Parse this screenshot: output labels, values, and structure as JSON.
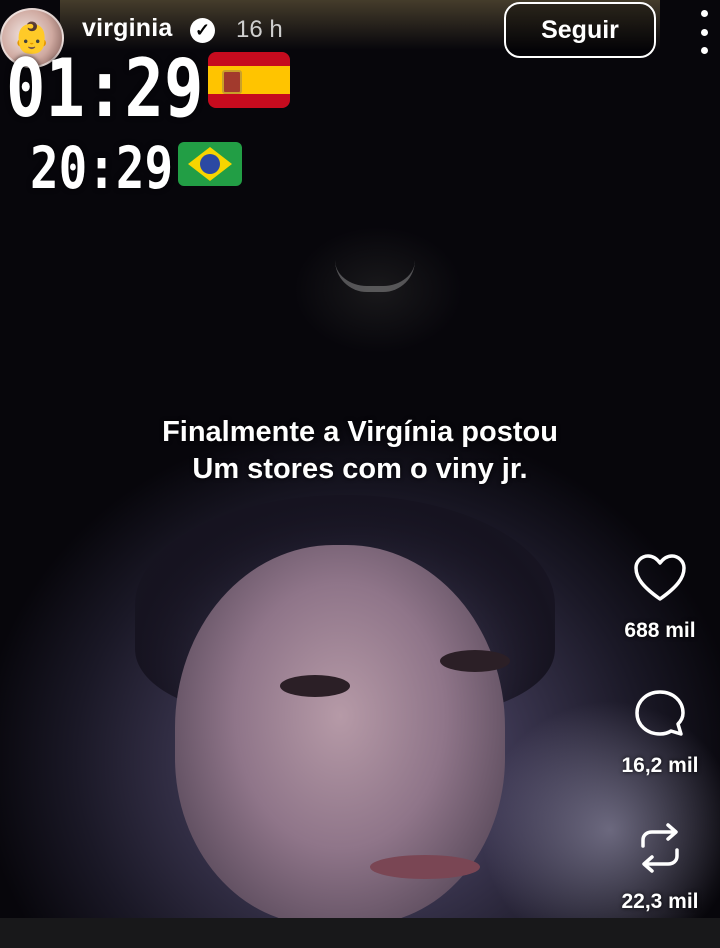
{
  "header": {
    "username": "virginia",
    "verified_icon": "verified-check-icon",
    "time_ago": "16 h",
    "follow_label": "Seguir",
    "more_icon": "more-vertical-icon"
  },
  "overlay": {
    "spain_time": "01:29",
    "brazil_time": "20:29",
    "spain_flag": "spain-flag-icon",
    "brazil_flag": "brazil-flag-icon",
    "caption_line1": "Finalmente a Virgínia postou",
    "caption_line2": "Um stores com o viny jr."
  },
  "actions": {
    "likes": "688 mil",
    "comments": "16,2 mil",
    "reposts": "22,3 mil"
  },
  "colors": {
    "text": "#ffffff",
    "background": "#000000"
  }
}
